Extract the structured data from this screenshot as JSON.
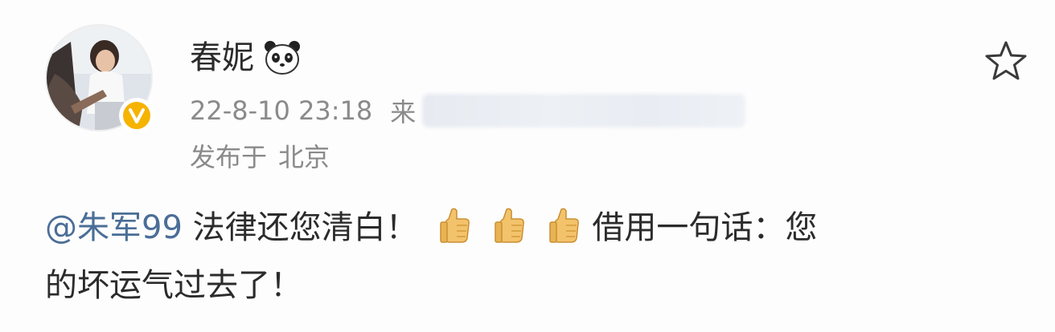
{
  "post": {
    "username": "春妮",
    "date_time": "22-8-10 23:18",
    "source_prefix": "来",
    "location_label": "发布于",
    "location_value": "北京",
    "content": {
      "mention": "@朱军99",
      "text_1": "法律还您清白！",
      "emoji": "thumbs-up-icon",
      "emoji_count": 3,
      "text_2": "借用一句话：您",
      "text_3": "的坏运气过去了！"
    }
  },
  "icons": {
    "verified_badge": "verified-v-icon",
    "username_emoji": "panda-icon",
    "favorite": "star-icon"
  },
  "colors": {
    "mention": "#4a6e97",
    "verified": "#f6b300",
    "meta_text": "#8a8a8a",
    "body_text": "#2b2b2b"
  }
}
